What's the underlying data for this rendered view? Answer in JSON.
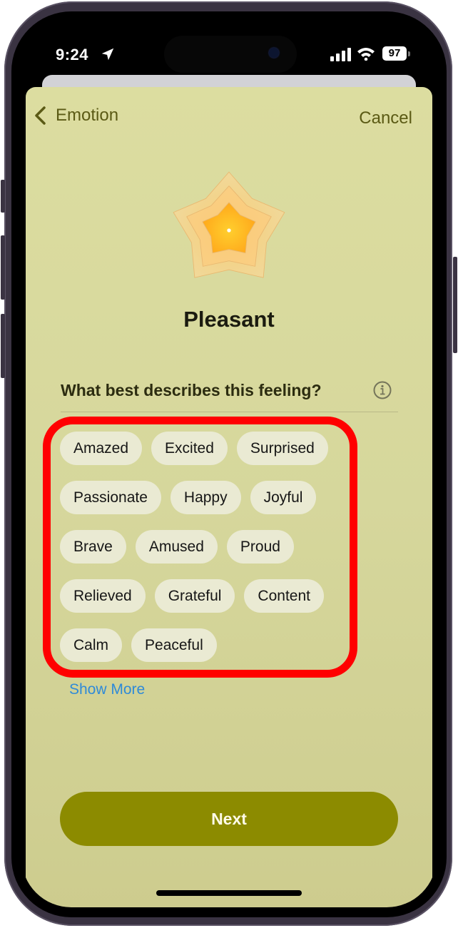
{
  "status_bar": {
    "time": "9:24",
    "location_icon": "location-arrow-icon",
    "signal_icon": "cellular-signal-icon",
    "wifi_icon": "wifi-icon",
    "battery_level": "97"
  },
  "nav": {
    "back_label": "Emotion",
    "back_icon": "chevron-left-icon",
    "cancel_label": "Cancel"
  },
  "emotion": {
    "icon": "flower-icon",
    "title": "Pleasant"
  },
  "question": {
    "text": "What best describes this feeling?",
    "info_icon": "info-circle-icon"
  },
  "feelings": [
    [
      "Amazed",
      "Excited",
      "Surprised"
    ],
    [
      "Passionate",
      "Happy",
      "Joyful"
    ],
    [
      "Brave",
      "Amused",
      "Proud"
    ],
    [
      "Relieved",
      "Grateful",
      "Content"
    ],
    [
      "Calm",
      "Peaceful"
    ]
  ],
  "show_more_label": "Show More",
  "next_label": "Next",
  "colors": {
    "sheet_background": "#d8d99c",
    "accent": "#8c8b00",
    "nav_text": "#5b5a15",
    "chip_background": "#eaead3",
    "link": "#2f8ad8",
    "highlight": "#ff0000"
  }
}
